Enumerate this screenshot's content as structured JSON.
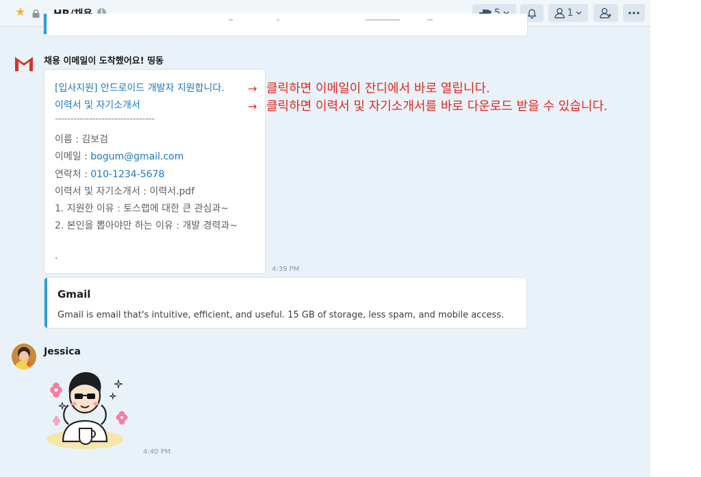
{
  "header": {
    "channel_name": "HR/채용",
    "integrations_count": "5",
    "members_count": "1"
  },
  "email_message": {
    "sender": "채용 이메일이 도착했어요! 띵동",
    "subject_link": "[입사지원] 안드로이드 개발자 지원합니다.",
    "attachment_link": "이력서 및 자기소개서",
    "divider": "--------------------------------",
    "name_label": "이름 : ",
    "name_value": "김보검",
    "email_label": "이메일 : ",
    "email_value": "bogum@gmail.com",
    "phone_label": "연락처 : ",
    "phone_value": "010-1234-5678",
    "resume_line": "이력서 및 자기소개서 : 이력서.pdf",
    "reason1": "1. 지원한 이유 : 토스랩에 대한 큰 관심과~",
    "reason2": "2. 본인을 뽑아야만 하는 이유 : 개발 경력과~",
    "dot": ".",
    "time": "4:39 PM"
  },
  "annotations": {
    "arrow": "→",
    "note1": "클릭하면 이메일이 잔디에서 바로 열립니다.",
    "note2": "클릭하면 이력서 및 자기소개서를 바로 다운로드 받을 수 있습니다."
  },
  "link_preview": {
    "title": "Gmail",
    "description": "Gmail is email that's intuitive, efficient, and useful. 15 GB of storage, less spam, and mobile access."
  },
  "jessica_message": {
    "sender": "Jessica",
    "time": "4:40 PM"
  },
  "colors": {
    "accent_blue": "#2a9fd8",
    "link_blue": "#1a79c5",
    "annotation_red": "#e0281f",
    "star_yellow": "#f2b61f"
  }
}
